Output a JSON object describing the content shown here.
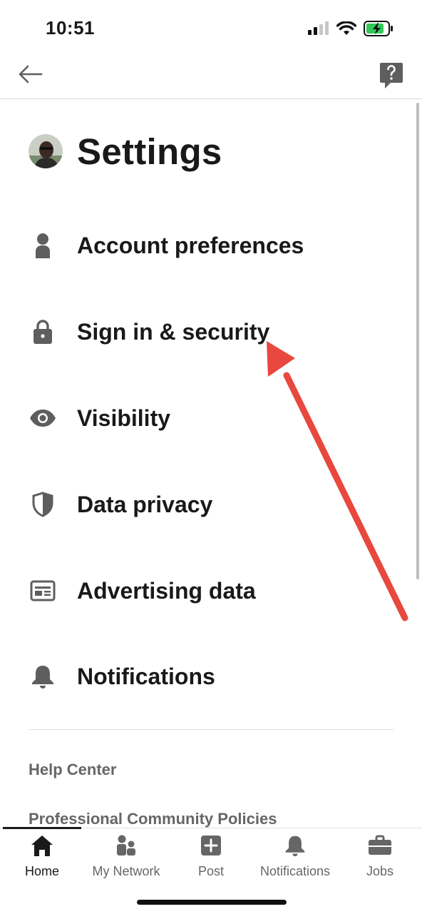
{
  "status_bar": {
    "time": "10:51"
  },
  "header": {
    "title": "Settings"
  },
  "settings_items": [
    {
      "label": "Account preferences",
      "icon": "person-icon"
    },
    {
      "label": "Sign in & security",
      "icon": "lock-icon"
    },
    {
      "label": "Visibility",
      "icon": "eye-icon"
    },
    {
      "label": "Data privacy",
      "icon": "shield-icon"
    },
    {
      "label": "Advertising data",
      "icon": "ad-card-icon"
    },
    {
      "label": "Notifications",
      "icon": "bell-icon"
    }
  ],
  "links": [
    {
      "label": "Help Center"
    },
    {
      "label": "Professional Community Policies"
    }
  ],
  "bottom_nav": [
    {
      "label": "Home",
      "icon": "home-icon",
      "active": true
    },
    {
      "label": "My Network",
      "icon": "network-icon"
    },
    {
      "label": "Post",
      "icon": "plus-box-icon"
    },
    {
      "label": "Notifications",
      "icon": "bell-icon"
    },
    {
      "label": "Jobs",
      "icon": "briefcase-icon"
    }
  ],
  "colors": {
    "text_primary": "#191919",
    "text_secondary": "#666666",
    "icon_gray": "#5e5e5e",
    "annotation_red": "#e8483d",
    "battery_green": "#34c759"
  }
}
